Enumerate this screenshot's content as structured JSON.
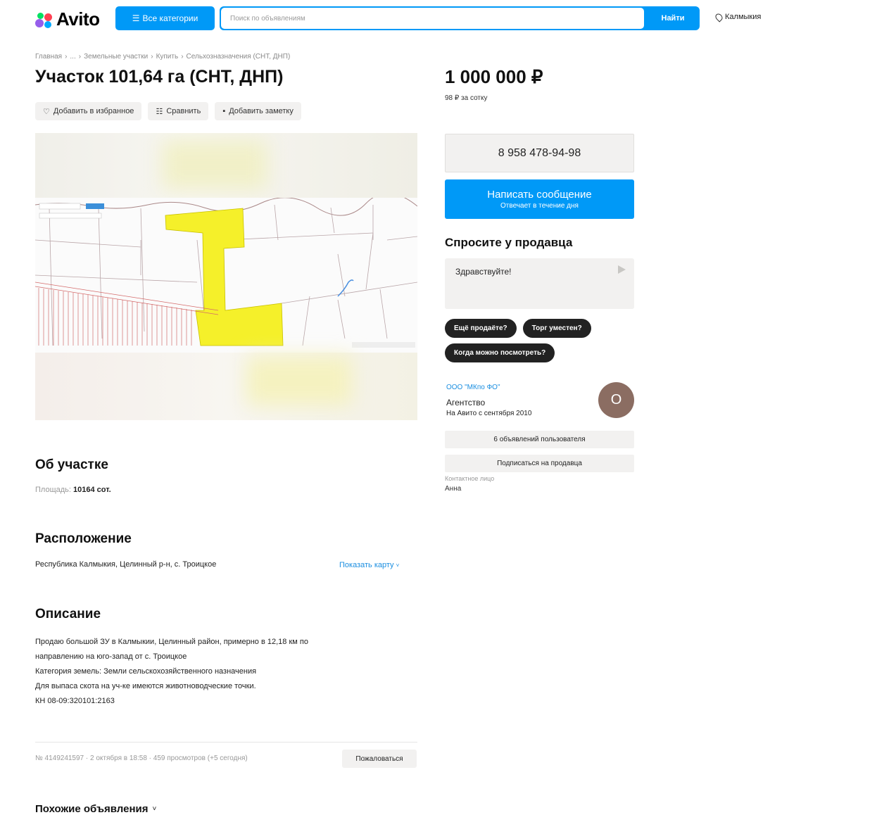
{
  "header": {
    "logo_text": "Avito",
    "categories_button": "Все категории",
    "search_placeholder": "Поиск по объявлениям",
    "search_button": "Найти",
    "region": "Калмыкия"
  },
  "breadcrumbs": [
    "Главная",
    "›",
    "...",
    "›",
    "Земельные участки",
    "›",
    "Купить",
    "›",
    "Сельхозназначения (СНТ, ДНП)"
  ],
  "listing": {
    "title": "Участок 101,64 га (СНТ, ДНП)",
    "price": "1 000 000 ₽",
    "price_per_unit": "98 ₽ за сотку"
  },
  "actions": {
    "favorite": "Добавить в избранное",
    "compare": "Сравнить",
    "note": "Добавить заметку"
  },
  "contact": {
    "phone": "8 958 478-94-98",
    "message_button": "Написать сообщение",
    "message_sub": "Отвечает в течение дня",
    "ask_title": "Спросите у продавца",
    "ask_text": "Здравствуйте!",
    "chips": [
      "Ещё продаёте?",
      "Торг уместен?",
      "Когда можно посмотреть?"
    ]
  },
  "seller": {
    "name": "ООО \"МКпо ФО\"",
    "type": "Агентство",
    "since": "На Авито с сентября 2010",
    "avatar_letter": "О",
    "listings_button": "6 объявлений пользователя",
    "subscribe_button": "Подписаться на продавца",
    "contact_label": "Контактное лицо",
    "contact_name": "Анна"
  },
  "about": {
    "heading": "Об участке",
    "area_label": "Площадь:",
    "area_value": "10164 сот."
  },
  "location": {
    "heading": "Расположение",
    "address": "Республика Калмыкия, Целинный р-н, с. Троицкое",
    "show_map": "Показать карту"
  },
  "description": {
    "heading": "Описание",
    "lines": [
      "Продаю большой ЗУ в Калмыкии, Целинный район, примерно в 12,18 км по",
      "направлению на юго-запад от с. Троицкое",
      "Категория земель: Земли сельскохозяйственного назначения",
      "Для выпаса скота на уч-ке имеются животноводческие точки.",
      "КН 08-09:320101:2163"
    ]
  },
  "footer": {
    "meta": "№ 4149241597 · 2 октября в 18:58 · 459 просмотров (+5 сегодня)",
    "report_button": "Пожаловаться",
    "similar": "Похожие объявления"
  },
  "colors": {
    "accent": "#0099f7",
    "link": "#1a8ee0",
    "plot_yellow": "#f5f02a"
  }
}
